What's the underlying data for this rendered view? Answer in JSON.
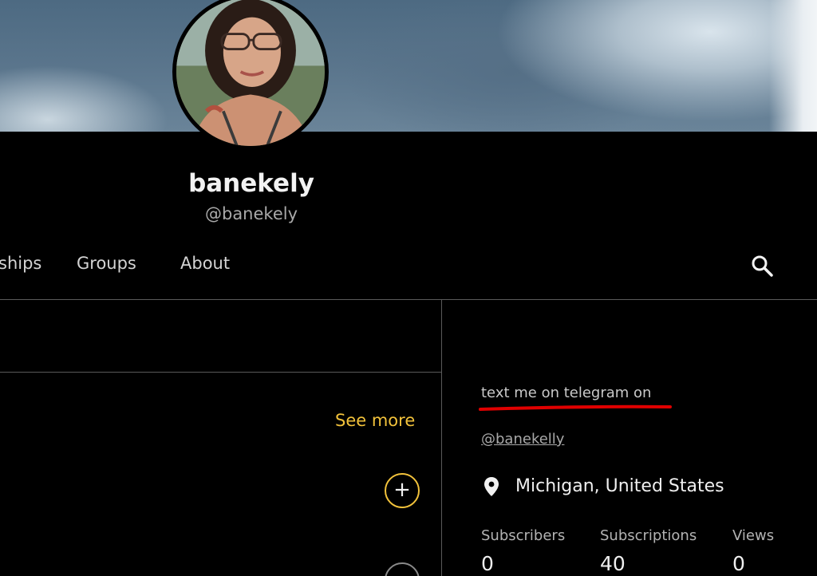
{
  "profile": {
    "display_name": "banekely",
    "handle": "@banekely"
  },
  "tabs": [
    {
      "label": "ships"
    },
    {
      "label": "Groups"
    },
    {
      "label": "About"
    }
  ],
  "sidebar_left": {
    "see_more_label": "See more",
    "add_button_label": "+"
  },
  "about": {
    "bio_text": "text me on telegram on",
    "bio_link": "@banekelly",
    "location": "Michigan, United States",
    "stats": [
      {
        "label": "Subscribers",
        "value": "0"
      },
      {
        "label": "Subscriptions",
        "value": "40"
      },
      {
        "label": "Views",
        "value": "0"
      }
    ]
  },
  "colors": {
    "accent": "#f2c23b",
    "annotation": "#e00000",
    "background": "#000000"
  },
  "icons": {
    "search": "search-icon",
    "location": "location-pin-icon"
  }
}
